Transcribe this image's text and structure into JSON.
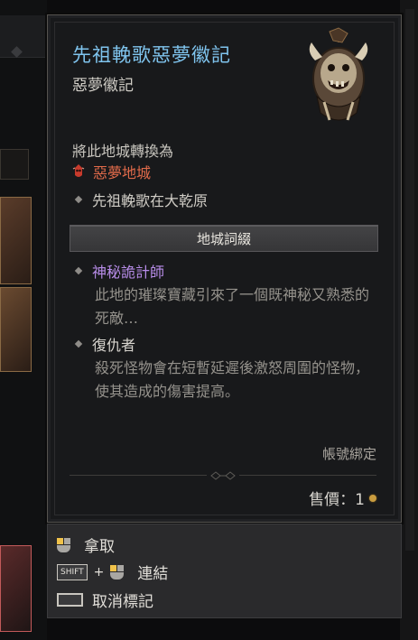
{
  "item": {
    "name": "先祖輓歌惡夢徽記",
    "type": "惡夢徽記",
    "convert_label": "將此地城轉換為",
    "dungeon_type": "惡夢地城",
    "dungeon_name": "先祖輓歌在大乾原",
    "affix_header": "地城詞綴",
    "affixes": [
      {
        "title": "神秘詭計師",
        "desc": "此地的璀璨寶藏引來了一個既神秘又熟悉的死敵…",
        "color": "#b78ce8"
      },
      {
        "title": "復仇者",
        "desc": "殺死怪物會在短暫延遲後激怒周圍的怪物，使其造成的傷害提高。",
        "color": "#d8d5cf"
      }
    ],
    "bound": "帳號綁定",
    "price_label": "售價：1",
    "icons": {
      "dungeon": "nightmare-dungeon-icon",
      "bullet": "diamond-bullet-icon",
      "currency": "gold-coin-icon"
    }
  },
  "controls": [
    {
      "label": "拿取",
      "input": "mouse-left-click-icon"
    },
    {
      "key": "SHIFT",
      "plus": "+",
      "label": "連結",
      "input": "mouse-left-click-icon"
    },
    {
      "label": "取消標記",
      "input": "spacebar-key-icon"
    }
  ],
  "colors": {
    "name": "#7fc4ee",
    "dungeon_type": "#e06a4a",
    "affix_mystic": "#b78ce8",
    "gold": "#c99c3f"
  }
}
